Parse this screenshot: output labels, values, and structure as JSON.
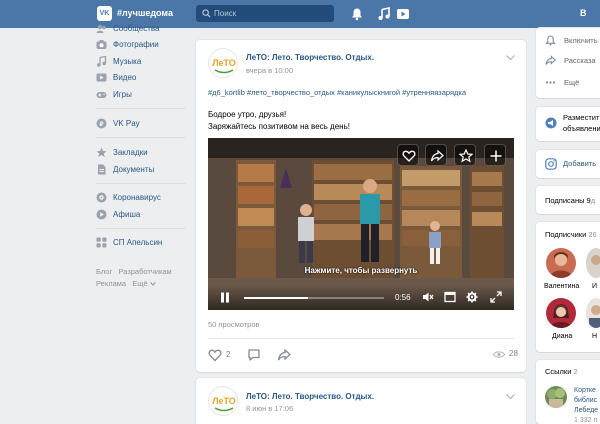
{
  "header": {
    "logo_text": "VK",
    "community_tag": "#лучшедома",
    "search_placeholder": "Поиск",
    "right_text": "В",
    "colors": {
      "header_bg": "#4a76a8",
      "link": "#2a5885",
      "page_bg": "#edeef0"
    }
  },
  "sidebar": {
    "items": [
      {
        "label": "Сообщества",
        "icon": "groups-icon"
      },
      {
        "label": "Фотографии",
        "icon": "camera-icon"
      },
      {
        "label": "Музыка",
        "icon": "music-note-icon"
      },
      {
        "label": "Видео",
        "icon": "video-icon"
      },
      {
        "label": "Игры",
        "icon": "gamepad-icon"
      },
      {
        "label": "VK Pay",
        "icon": "vk-pay-icon"
      },
      {
        "label": "Закладки",
        "icon": "star-icon"
      },
      {
        "label": "Документы",
        "icon": "document-icon"
      },
      {
        "label": "Коронавирус",
        "icon": "coronavirus-icon"
      },
      {
        "label": "Афиша",
        "icon": "play-circle-icon"
      },
      {
        "label": "СП Апельсин",
        "icon": "apps-icon"
      }
    ],
    "footer": {
      "blog": "Блог",
      "developers": "Разработчикам",
      "ads": "Реклама",
      "more": "Ещё"
    }
  },
  "posts": [
    {
      "author": "ЛеТО: Лето. Творчество. Отдых.",
      "time": "вчера в 10:00",
      "hashtags": "#д6_kortlib #лето_творчество_отдых #каникулыскнигой #утренняязарядка",
      "text_line1": "Бодрое утро, друзья!",
      "text_line2": "Заряжайтесь позитивом на весь день!",
      "video": {
        "caption": "Нажмите, чтобы развернуть",
        "time": "0:56",
        "progress": 0.46
      },
      "views": "50 просмотров",
      "likes": "2",
      "view_count": "28"
    },
    {
      "author": "ЛеТО: Лето. Творчество. Отдых.",
      "time": "8 июн в 17:06"
    }
  ],
  "right": {
    "menu": {
      "turn_on": "Включить",
      "share": "Рассказа",
      "more": "Ещё"
    },
    "ads": {
      "line1": "Разместит",
      "line2": "объявлени"
    },
    "add": "Добавить",
    "subscriptions": {
      "label": "Подписаны 9",
      "suffix": "д"
    },
    "followers": {
      "label": "Подписчики",
      "count": "26",
      "people": [
        {
          "name": "Валентина"
        },
        {
          "name": "Диана"
        }
      ],
      "cut_names": [
        "И",
        "Н"
      ]
    },
    "links": {
      "label": "Ссылки",
      "count": "2",
      "items": [
        {
          "line1": "Кортке",
          "line2": "библис",
          "line3": "Лебеде",
          "line4": "1 332 п"
        }
      ]
    }
  }
}
